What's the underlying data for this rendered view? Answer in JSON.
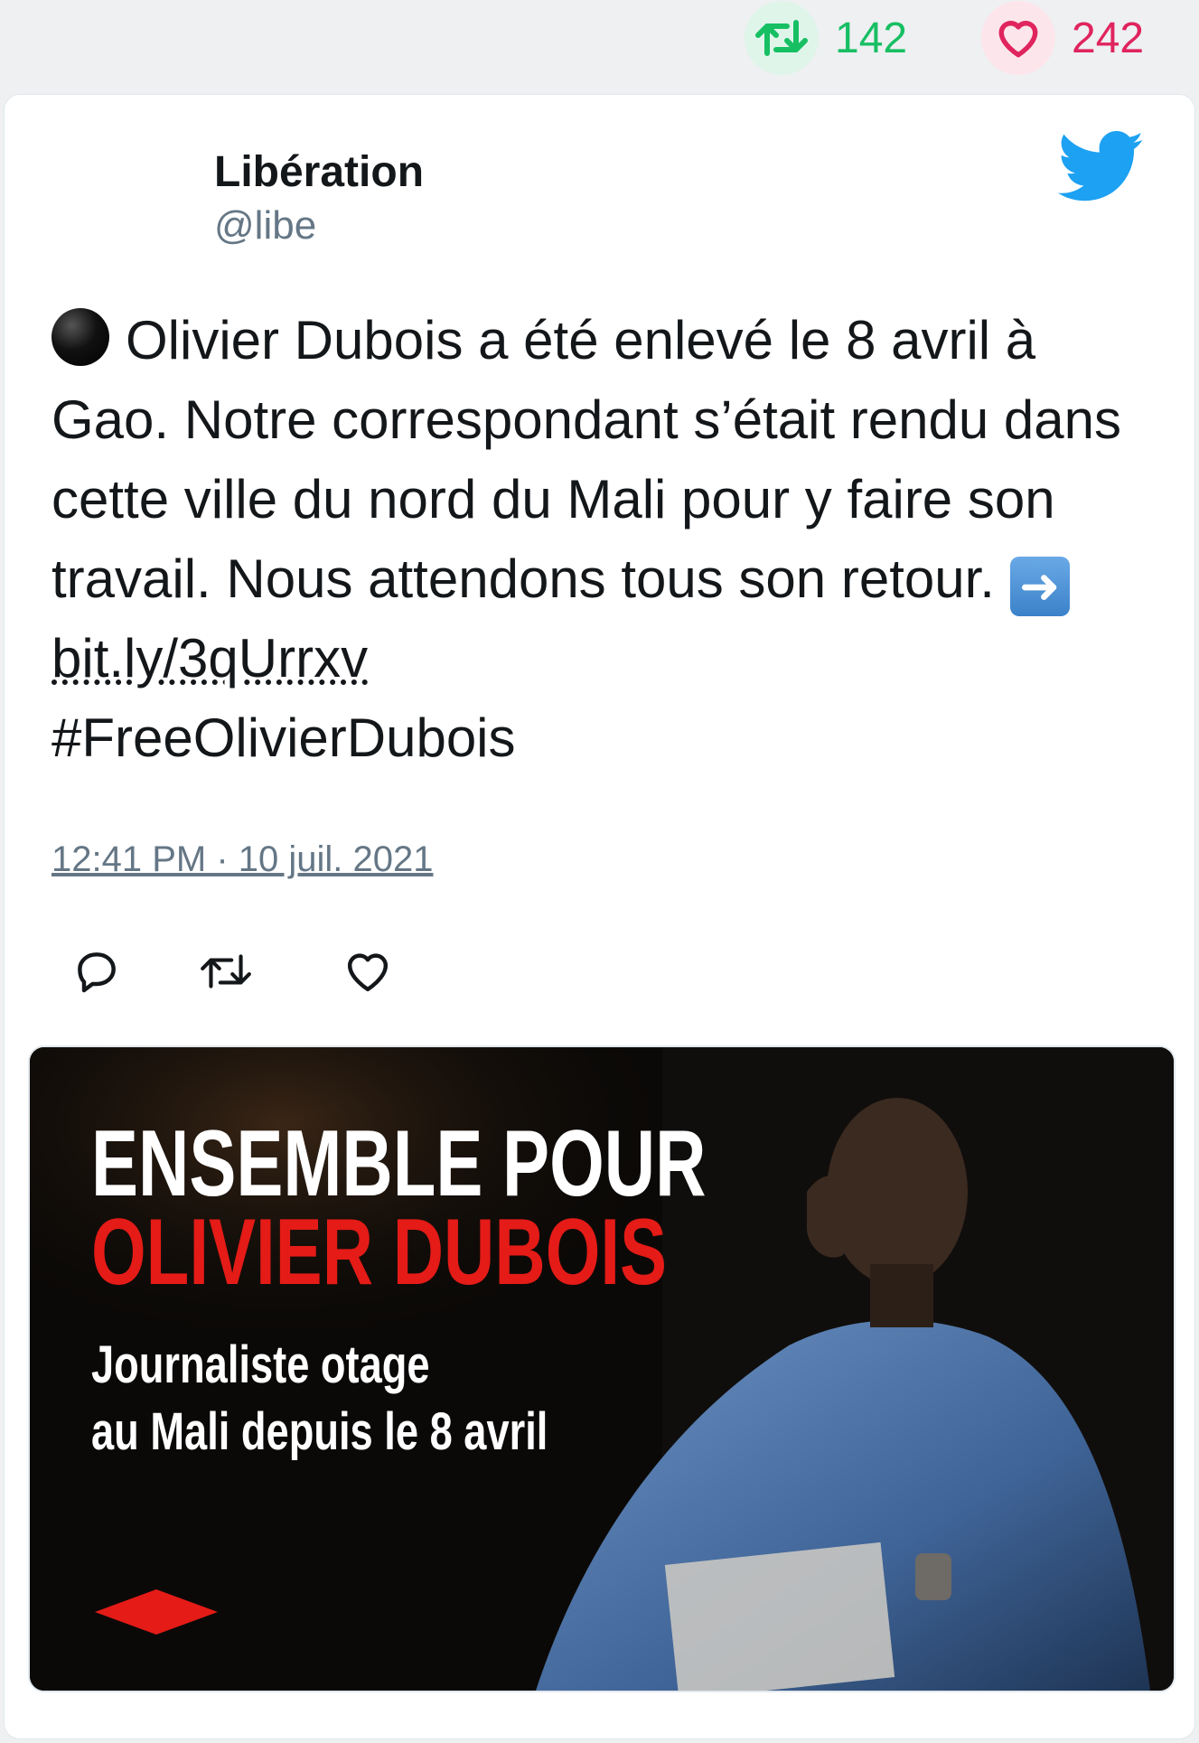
{
  "top_stats": {
    "retweets": "142",
    "likes": "242"
  },
  "tweet": {
    "author_name": "Libération",
    "author_handle": "@libe",
    "text_1": "Olivier Dubois a été enlevé le 8 avril à Gao. Notre correspondant s’était rendu dans cette ville du nord du Mali pour y faire son travail. Nous attendons tous son retour.",
    "link": "bit.ly/3qUrrxv",
    "hashtag": "#FreeOlivierDubois",
    "timestamp": "12:41 PM · 10 juil. 2021"
  },
  "media": {
    "line1": "ENSEMBLE POUR",
    "line2": "OLIVIER DUBOIS",
    "line3": "Journaliste otage",
    "line4": "au Mali depuis le 8 avril"
  },
  "colors": {
    "retweet_green": "#17bf63",
    "like_red": "#e0245e",
    "twitter_blue": "#1da1f2",
    "headline_red": "#e41b17"
  },
  "icons": [
    "retweet-icon",
    "heart-icon",
    "twitter-bird-icon",
    "reply-icon",
    "black-circle-emoji",
    "right-arrow-emoji",
    "liberation-logo"
  ]
}
